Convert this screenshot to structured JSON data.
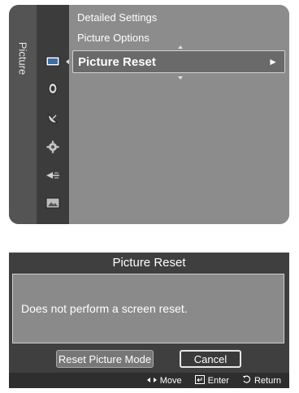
{
  "menu": {
    "tab_label": "Picture",
    "items": [
      {
        "label": "Detailed Settings"
      },
      {
        "label": "Picture Options"
      }
    ],
    "selected_item": {
      "label": "Picture Reset",
      "arrow": "►"
    },
    "icons": [
      "picture-icon",
      "sound-icon",
      "satellite-icon",
      "setup-icon",
      "input-icon",
      "application-icon"
    ]
  },
  "dialog": {
    "title": "Picture Reset",
    "message": "Does not perform a screen reset.",
    "buttons": {
      "reset": "Reset Picture Mode",
      "cancel": "Cancel"
    },
    "help": {
      "move": "Move",
      "enter": "Enter",
      "return": "Return"
    }
  }
}
